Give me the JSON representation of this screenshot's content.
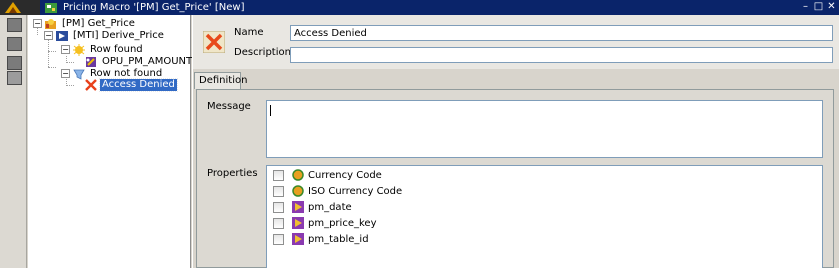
{
  "window": {
    "title": "Pricing Macro '[PM] Get_Price' [New]",
    "controls": [
      "–",
      "□",
      "✕"
    ]
  },
  "tree": {
    "root": {
      "label": "[PM] Get_Price"
    },
    "child": {
      "label": "[MTI] Derive_Price"
    },
    "row_found": {
      "label": "Row found"
    },
    "amount": {
      "label": "OPU_PM_AMOUNT"
    },
    "row_not_found": {
      "label": "Row not found"
    },
    "access_denied": {
      "label": "Access Denied"
    }
  },
  "form": {
    "name_label": "Name",
    "name_value": "Access Denied",
    "description_label": "Description",
    "description_value": ""
  },
  "tabs": [
    "Definition"
  ],
  "definition": {
    "message_label": "Message",
    "message_value": "",
    "properties_label": "Properties",
    "properties": [
      {
        "label": "Currency Code",
        "icon": "circle-icon",
        "checked": false
      },
      {
        "label": "ISO Currency Code",
        "icon": "circle-icon",
        "checked": false
      },
      {
        "label": "pm_date",
        "icon": "arrow-icon",
        "checked": false
      },
      {
        "label": "pm_price_key",
        "icon": "arrow-icon",
        "checked": false
      },
      {
        "label": "pm_table_id",
        "icon": "arrow-icon",
        "checked": false
      }
    ]
  },
  "colors": {
    "titlebar": "#0a246a",
    "selection": "#316ac5"
  }
}
